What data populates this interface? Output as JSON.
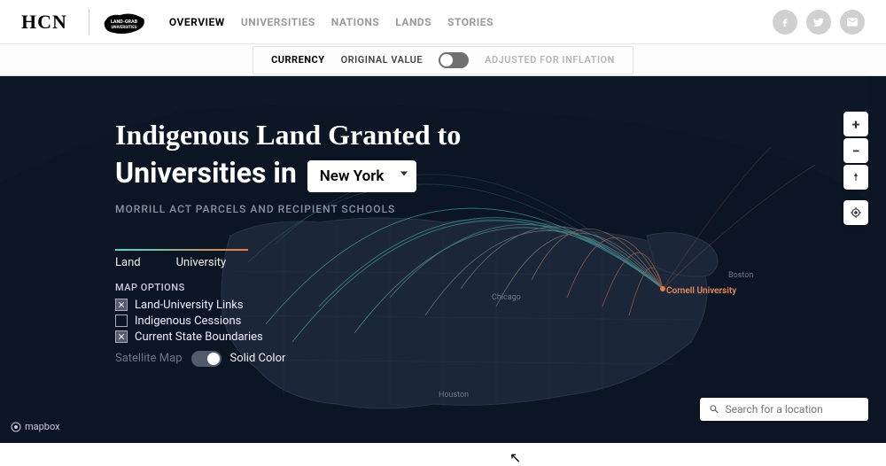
{
  "header": {
    "brand": "HCN",
    "logo_label": "LAND-GRAB UNIVERSITIES",
    "nav": [
      "OVERVIEW",
      "UNIVERSITIES",
      "NATIONS",
      "LANDS",
      "STORIES"
    ],
    "nav_active_index": 0
  },
  "subbar": {
    "label": "CURRENCY",
    "option_left": "ORIGINAL VALUE",
    "option_right": "ADJUSTED FOR INFLATION",
    "toggle_on_right": false
  },
  "map": {
    "title_line1": "Indigenous Land Granted to",
    "title_line2_prefix": "Universities in",
    "state_selected": "New York",
    "subtitle": "MORRILL ACT PARCELS AND RECIPIENT SCHOOLS",
    "legend": {
      "left": "Land",
      "right": "University"
    },
    "options_title": "MAP OPTIONS",
    "options": [
      {
        "label": "Land-University Links",
        "checked": true
      },
      {
        "label": "Indigenous Cessions",
        "checked": false
      },
      {
        "label": "Current State Boundaries",
        "checked": true
      }
    ],
    "style": {
      "left": "Satellite Map",
      "right": "Solid Color",
      "solid_selected": true
    },
    "university_label": "Cornell University",
    "cities": [
      "Chicago",
      "Boston",
      "Houston"
    ],
    "search_placeholder": "Search for a location",
    "attribution": "mapbox"
  },
  "colors": {
    "bg": "#0c1524",
    "land": "#1b2638",
    "arc_cyan": "#4fd6d6",
    "arc_orange": "#f07b3f"
  }
}
